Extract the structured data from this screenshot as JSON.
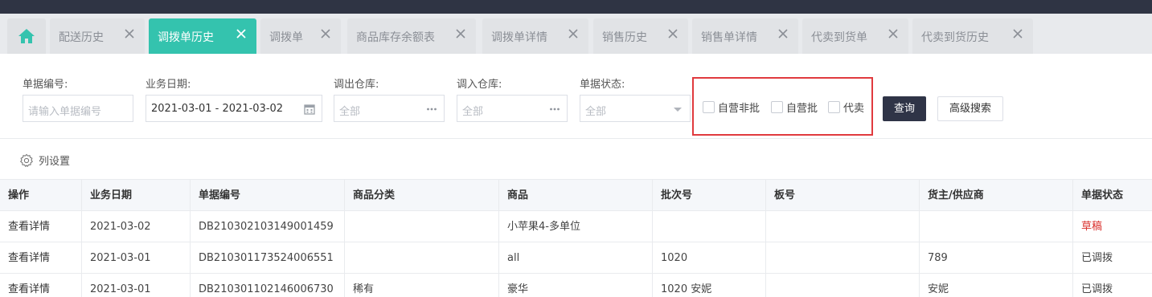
{
  "tabs": [
    {
      "label": "配送历史",
      "active": false
    },
    {
      "label": "调拨单历史",
      "active": true
    },
    {
      "label": "调拨单",
      "active": false
    },
    {
      "label": "商品库存余额表",
      "active": false
    },
    {
      "label": "调拨单详情",
      "active": false
    },
    {
      "label": "销售历史",
      "active": false
    },
    {
      "label": "销售单详情",
      "active": false
    },
    {
      "label": "代卖到货单",
      "active": false
    },
    {
      "label": "代卖到货历史",
      "active": false
    }
  ],
  "filters": {
    "doc_no": {
      "label": "单据编号:",
      "placeholder": "请输入单据编号"
    },
    "biz_date": {
      "label": "业务日期:",
      "value": "2021-03-01 - 2021-03-02"
    },
    "out_wh": {
      "label": "调出仓库:",
      "placeholder": "全部"
    },
    "in_wh": {
      "label": "调入仓库:",
      "placeholder": "全部"
    },
    "status": {
      "label": "单据状态:",
      "placeholder": "全部"
    }
  },
  "checkboxes": [
    {
      "label": "自营非批",
      "checked": false
    },
    {
      "label": "自营批",
      "checked": false
    },
    {
      "label": "代卖",
      "checked": false
    }
  ],
  "buttons": {
    "query": "查询",
    "advanced": "高级搜索"
  },
  "column_settings": "列设置",
  "table": {
    "headers": [
      "操作",
      "业务日期",
      "单据编号",
      "商品分类",
      "商品",
      "批次号",
      "板号",
      "货主/供应商",
      "单据状态"
    ],
    "rows": [
      [
        "查看详情",
        "2021-03-02",
        "DB210302103149001459",
        "",
        "小苹果4-多单位",
        "",
        "",
        "",
        "草稿"
      ],
      [
        "查看详情",
        "2021-03-01",
        "DB210301173524006551",
        "",
        "all",
        "1020",
        "",
        "789",
        "已调拨"
      ],
      [
        "查看详情",
        "2021-03-01",
        "DB210301102146006730",
        "稀有",
        "豪华",
        "1020 安妮",
        "",
        "安妮",
        "已调拨"
      ]
    ]
  },
  "colors": {
    "accent": "#34c3ae",
    "dark": "#2f3447",
    "highlight": "#e03a3e",
    "draft": "#d9302c"
  }
}
